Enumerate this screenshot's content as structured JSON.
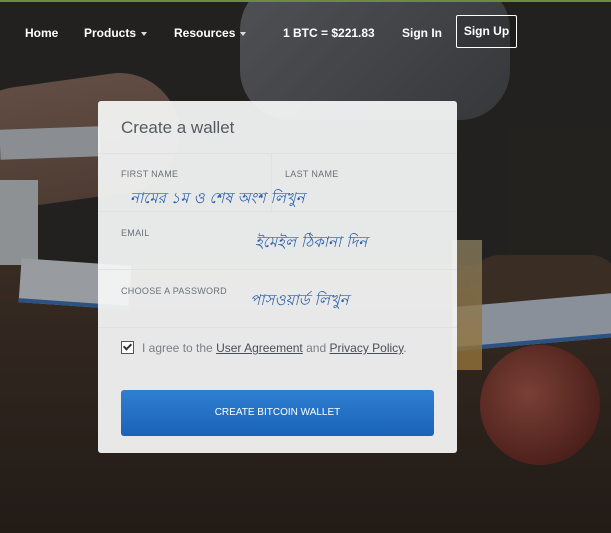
{
  "nav": {
    "home": "Home",
    "products": "Products",
    "resources": "Resources",
    "price": "1 BTC = $221.83",
    "signin": "Sign In",
    "signup": "Sign Up"
  },
  "form": {
    "title": "Create a wallet",
    "first_name_label": "FIRST NAME",
    "last_name_label": "LAST NAME",
    "name_annotation": "নামের ১ম ও শেষ অংশ লিখুন",
    "email_label": "EMAIL",
    "email_annotation": "ইমেইল ঠিকানা দিন",
    "password_label": "CHOOSE A PASSWORD",
    "password_annotation": "পাসওয়ার্ড  লিখুন",
    "agree_prefix": "I agree to the",
    "user_agreement": "User Agreement",
    "and": "and",
    "privacy_policy": "Privacy Policy",
    "period": ".",
    "submit": "CREATE BITCOIN WALLET"
  },
  "colors": {
    "accent": "#1a63b8",
    "annotation": "#2e62ad"
  }
}
